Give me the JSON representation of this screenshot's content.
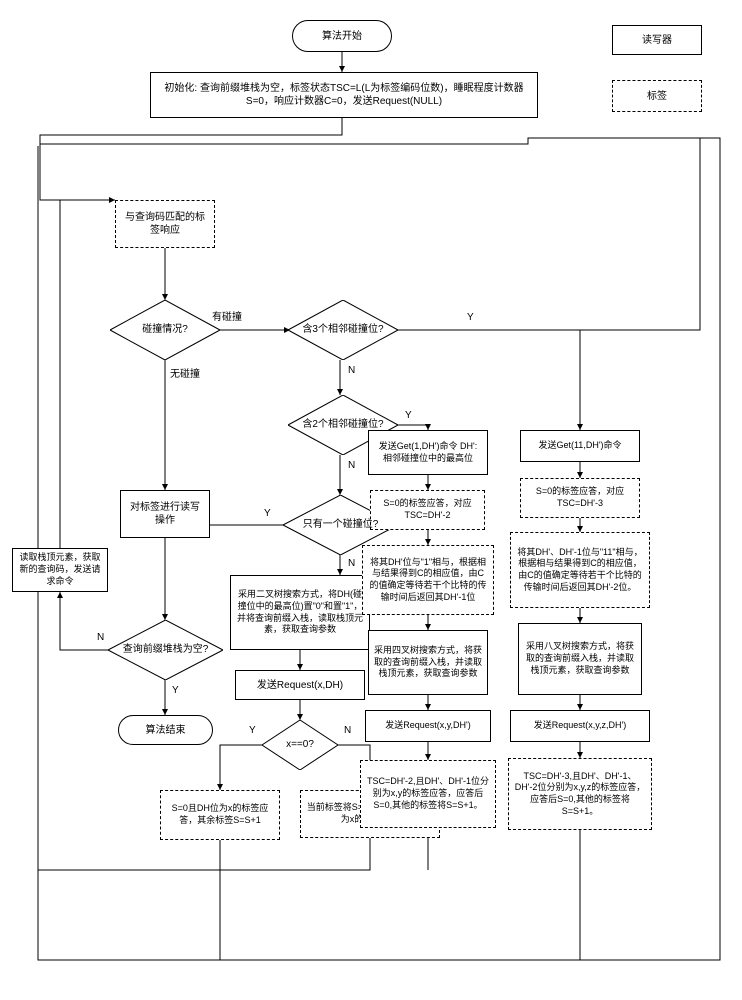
{
  "legend": {
    "reader": "读写器",
    "tag": "标签"
  },
  "nodes": {
    "start": "算法开始",
    "init": "初始化: 查询前缀堆栈为空，标签状态TSC=L(L为标签编码位数)，睡眠程度计数器S=0，响应计数器C=0，发送Request(NULL)",
    "match_resp": "与查询码匹配的标签响应",
    "collision_q": "碰撞情况?",
    "has_collision": "有碰撞",
    "no_collision": "无碰撞",
    "three_adj": "含3个相邻碰撞位?",
    "two_adj": "含2个相邻碰撞位?",
    "one_only": "只有一个碰撞位?",
    "rw_tag": "对标签进行读写操作",
    "pop_stack": "读取栈顶元素，获取新的查询码，发送请求命令",
    "stack_empty": "查询前缀堆栈为空?",
    "end": "算法结束",
    "binary_tree": "采用二叉树搜索方式，将DH(碰撞位中的最高位)置\"0\"和置\"1\"，并将查询前缀入栈，读取栈顶元素，获取查询参数",
    "req_xdh": "发送Request(x,DH)",
    "x_eq_0": "x==0?",
    "s0_dh_x": "S=0且DH位为x的标签应答，其余标签S=S+1",
    "cur_s_minus": "当前标签将S=S-1，S=0且DH位为x的标签应答",
    "send_get1": "发送Get(1,DH')命令\nDH': 相邻碰撞位中的最高位",
    "s0_resp2": "S=0的标签应答，对应TSC=DH'-2",
    "dh_prime_and1": "将其DH'位与\"1\"相与，根据相与结果得到C的相应值，由C的值确定等待若干个比特的传输时间后返回其DH'-1位",
    "quad_tree": "采用四叉树搜索方式，将获取的查询前缀入栈，并读取栈顶元素，获取查询参数",
    "req_xy": "发送Request(x,y,DH')",
    "tsc_dh2": "TSC=DH'-2,且DH'、DH'-1位分别为x,y的标签应答，应答后S=0,其他的标签将S=S+1。",
    "send_get11": "发送Get(11,DH')命令",
    "s0_resp3": "S=0的标签应答，对应TSC=DH'-3",
    "dh_prime_and11": "将其DH'、DH'-1位与\"11\"相与，根据相与结果得到C的相应值，由C的值确定等待若干个比特的传输时间后返回其DH'-2位。",
    "oct_tree": "采用八叉树搜索方式，将获取的查询前缀入栈，并读取栈顶元素，获取查询参数",
    "req_xyz": "发送Request(x,y,z,DH')",
    "tsc_dh3": "TSC=DH'-3,且DH'、DH'-1、DH'-2位分别为x,y,z的标签应答，应答后S=0,其他的标签将S=S+1。"
  },
  "labels": {
    "Y": "Y",
    "N": "N"
  }
}
